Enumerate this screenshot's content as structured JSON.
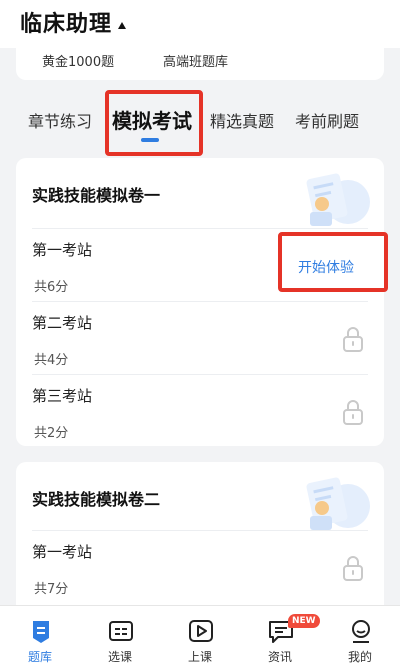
{
  "header": {
    "title": "临床助理"
  },
  "top_card": {
    "libraries": [
      "黄金1000题",
      "高端班题库"
    ]
  },
  "tabs": [
    {
      "label": "章节练习",
      "active": false
    },
    {
      "label": "模拟考试",
      "active": true
    },
    {
      "label": "精选真题",
      "active": false
    },
    {
      "label": "考前刷题",
      "active": false
    }
  ],
  "papers": [
    {
      "title": "实践技能模拟卷一",
      "stations": [
        {
          "name": "第一考站",
          "score": "共6分",
          "action": "开始体验",
          "locked": false
        },
        {
          "name": "第二考站",
          "score": "共4分",
          "locked": true
        },
        {
          "name": "第三考站",
          "score": "共2分",
          "locked": true
        }
      ]
    },
    {
      "title": "实践技能模拟卷二",
      "stations": [
        {
          "name": "第一考站",
          "score": "共7分",
          "locked": true
        }
      ]
    }
  ],
  "bottom_nav": [
    {
      "label": "题库",
      "icon": "question-bank-icon",
      "active": true
    },
    {
      "label": "选课",
      "icon": "course-select-icon",
      "active": false
    },
    {
      "label": "上课",
      "icon": "play-class-icon",
      "active": false
    },
    {
      "label": "资讯",
      "icon": "news-chat-icon",
      "active": false,
      "badge": "NEW"
    },
    {
      "label": "我的",
      "icon": "profile-icon",
      "active": false
    }
  ],
  "colors": {
    "accent": "#2f7de1",
    "highlight": "#e53327",
    "badge": "#f04a3a"
  }
}
